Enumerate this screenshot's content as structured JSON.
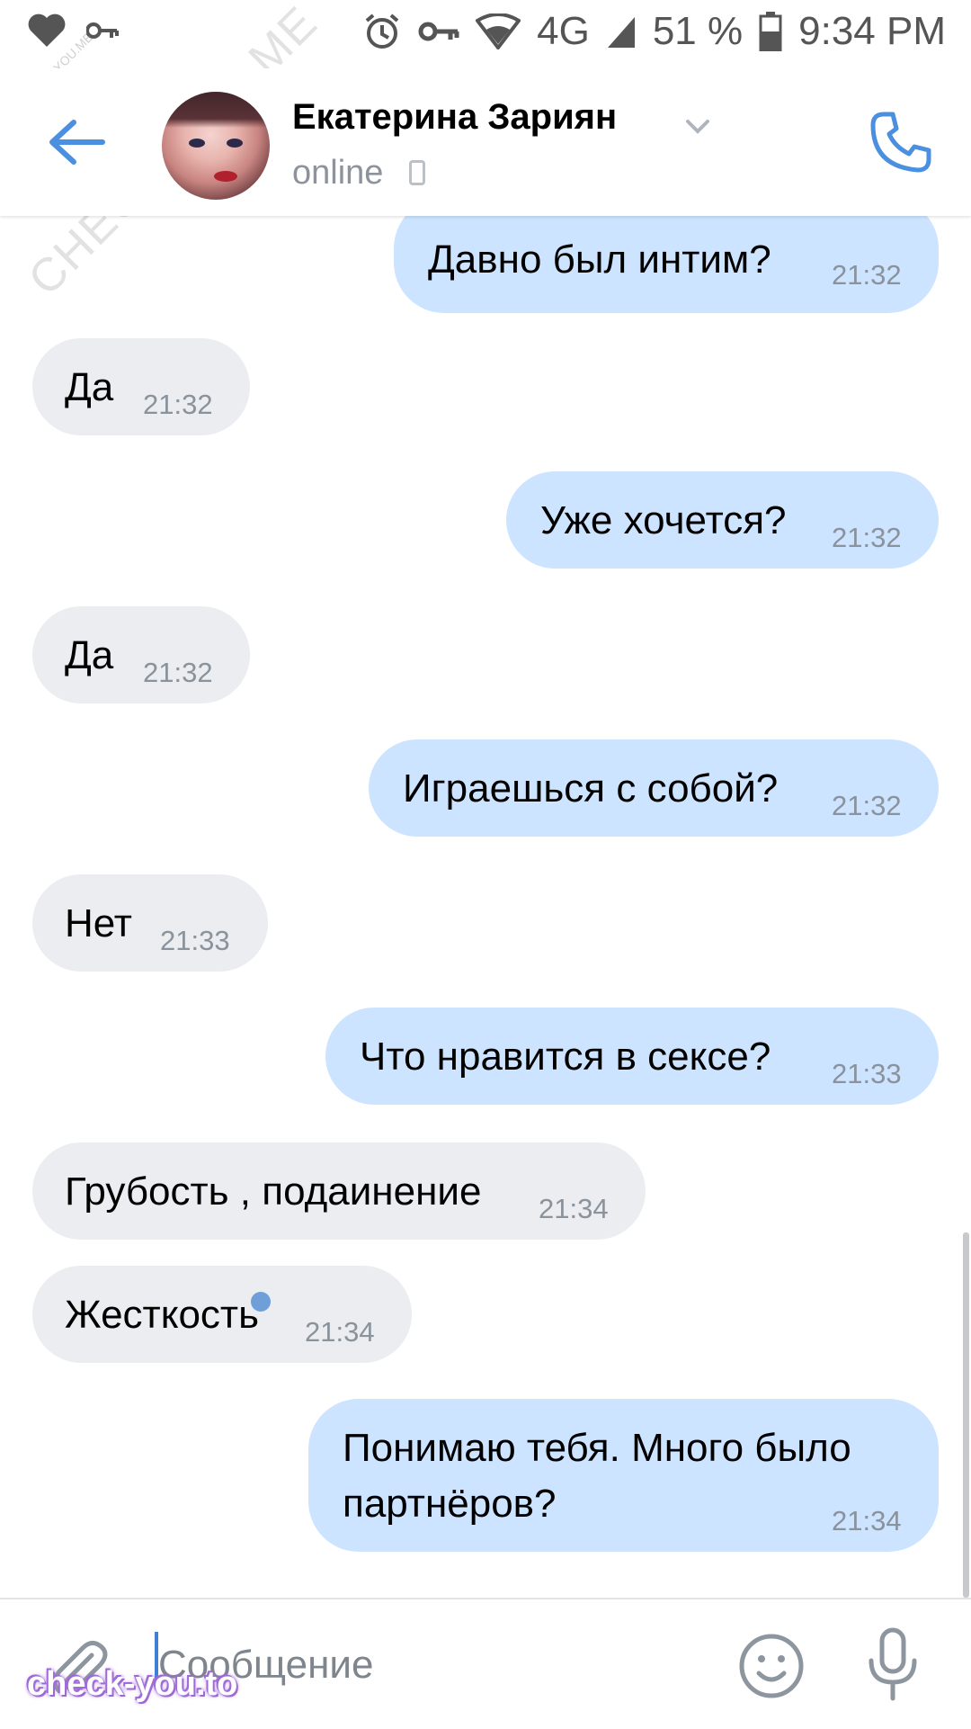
{
  "status_bar": {
    "network": "4G",
    "battery_percent": "51 %",
    "time": "9:34 PM"
  },
  "header": {
    "contact_name": "Екатерина Зариян",
    "status": "online"
  },
  "messages": [
    {
      "direction": "out",
      "text": "Давно был интим?",
      "time": "21:32"
    },
    {
      "direction": "in",
      "text": "Да",
      "time": "21:32"
    },
    {
      "direction": "out",
      "text": "Уже хочется?",
      "time": "21:32"
    },
    {
      "direction": "in",
      "text": "Да",
      "time": "21:32"
    },
    {
      "direction": "out",
      "text": "Играешься с собой?",
      "time": "21:32"
    },
    {
      "direction": "in",
      "text": "Нет",
      "time": "21:33"
    },
    {
      "direction": "out",
      "text": "Что нравится в сексе?",
      "time": "21:33"
    },
    {
      "direction": "in",
      "text": "Грубость , подаинение",
      "time": "21:34"
    },
    {
      "direction": "in",
      "text": "Жесткость",
      "time": "21:34"
    },
    {
      "direction": "out",
      "text_line1": "Понимаю тебя. Много было",
      "text_line2": "партнёров?",
      "time": "21:34",
      "unread": true
    }
  ],
  "composer": {
    "placeholder": "Сообщение"
  },
  "watermarks": {
    "diagonal": "CHECK-YOU.ME",
    "small": "CHECK-YOU.ME",
    "bottom": "check-you.to"
  },
  "colors": {
    "outgoing_bubble": "#cce4ff",
    "incoming_bubble": "#ebedf0",
    "accent": "#4a8fe0",
    "time_text": "#8a929c"
  }
}
